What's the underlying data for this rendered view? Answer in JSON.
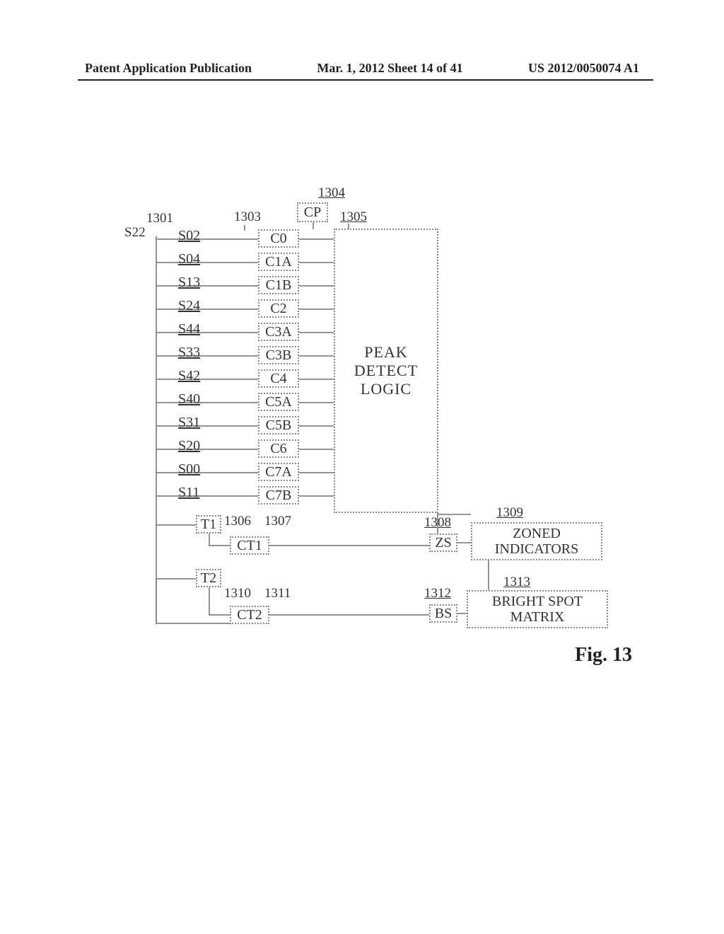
{
  "header": {
    "left": "Patent Application Publication",
    "center": "Mar. 1, 2012  Sheet 14 of 41",
    "right": "US 2012/0050074 A1"
  },
  "figure_caption": "Fig. 13",
  "signals": [
    {
      "label": "S02",
      "box": "C0"
    },
    {
      "label": "S04",
      "box": "C1A"
    },
    {
      "label": "S13",
      "box": "C1B"
    },
    {
      "label": "S24",
      "box": "C2"
    },
    {
      "label": "S44",
      "box": "C3A"
    },
    {
      "label": "S33",
      "box": "C3B"
    },
    {
      "label": "S42",
      "box": "C4"
    },
    {
      "label": "S40",
      "box": "C5A"
    },
    {
      "label": "S31",
      "box": "C5B"
    },
    {
      "label": "S20",
      "box": "C6"
    },
    {
      "label": "S00",
      "box": "C7A"
    },
    {
      "label": "S11",
      "box": "C7B"
    }
  ],
  "s22": "S22",
  "ref1301": "1301",
  "ref1303": "1303",
  "cp": "CP",
  "ref1304": "1304",
  "ref1305": "1305",
  "peak": {
    "l1": "PEAK",
    "l2": "DETECT",
    "l3": "LOGIC"
  },
  "t1": "T1",
  "ref1306": "1306",
  "ref1307": "1307",
  "ct1": "CT1",
  "zs": "ZS",
  "ref1308": "1308",
  "zoned": "ZONED\nINDICATORS",
  "ref1309": "1309",
  "t2": "T2",
  "ref1310": "1310",
  "ref1311": "1311",
  "ct2": "CT2",
  "bs": "BS",
  "ref1312": "1312",
  "bright": "BRIGHT SPOT\nMATRIX",
  "ref1313": "1313"
}
